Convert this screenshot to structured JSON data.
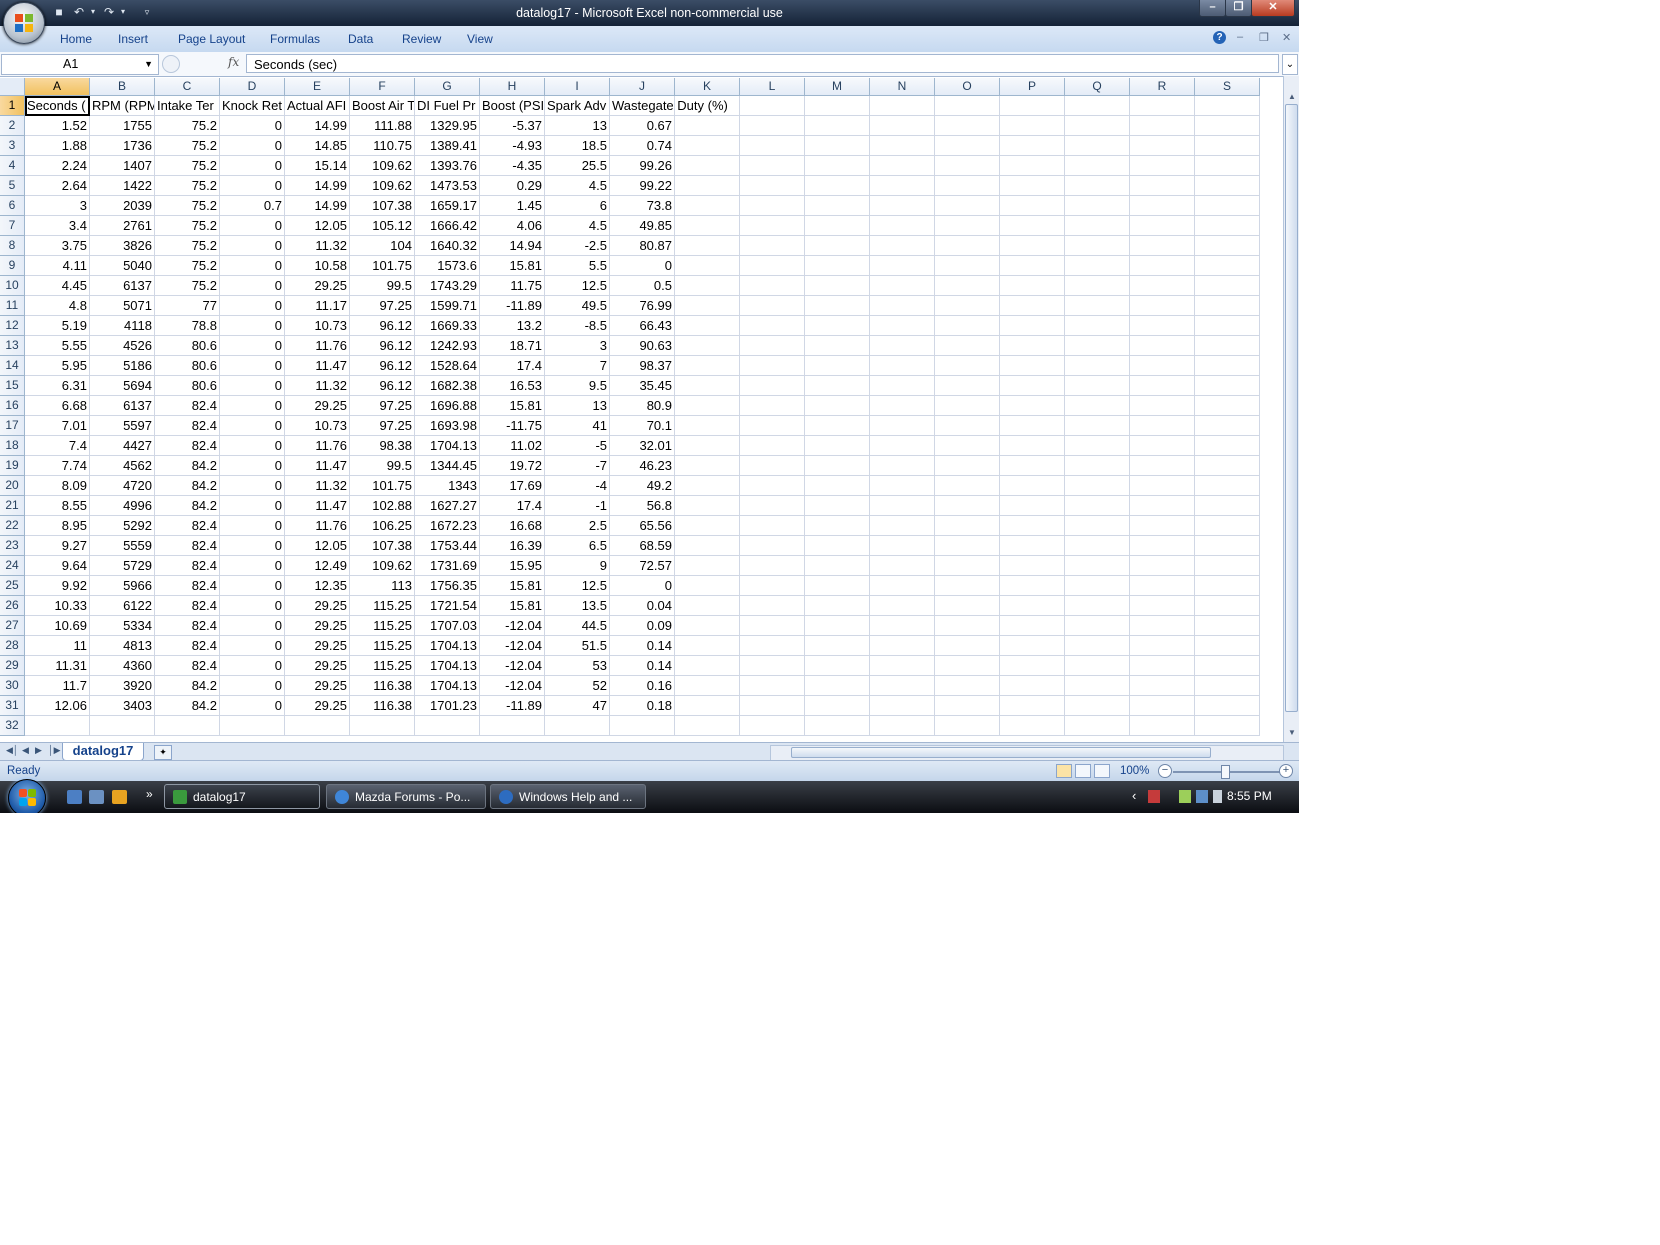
{
  "window": {
    "title": "datalog17 - Microsoft Excel non-commercial use"
  },
  "ribbon": {
    "tabs": [
      "Home",
      "Insert",
      "Page Layout",
      "Formulas",
      "Data",
      "Review",
      "View"
    ]
  },
  "formula_bar": {
    "name_box": "A1",
    "fx_label": "fx",
    "formula": "Seconds (sec)"
  },
  "sheet": {
    "columns": [
      "A",
      "B",
      "C",
      "D",
      "E",
      "F",
      "G",
      "H",
      "I",
      "J",
      "K",
      "L",
      "M",
      "N",
      "O",
      "P",
      "Q",
      "R",
      "S"
    ],
    "headers": [
      "Seconds (",
      "RPM (RPM",
      "Intake Ter",
      "Knock Ret",
      "Actual AFI",
      "Boost Air T",
      "DI Fuel Pr",
      "Boost (PSI",
      "Spark Adv",
      "Wastegate Duty (%)"
    ],
    "rows": [
      [
        "1.52",
        "1755",
        "75.2",
        "0",
        "14.99",
        "111.88",
        "1329.95",
        "-5.37",
        "13",
        "0.67"
      ],
      [
        "1.88",
        "1736",
        "75.2",
        "0",
        "14.85",
        "110.75",
        "1389.41",
        "-4.93",
        "18.5",
        "0.74"
      ],
      [
        "2.24",
        "1407",
        "75.2",
        "0",
        "15.14",
        "109.62",
        "1393.76",
        "-4.35",
        "25.5",
        "99.26"
      ],
      [
        "2.64",
        "1422",
        "75.2",
        "0",
        "14.99",
        "109.62",
        "1473.53",
        "0.29",
        "4.5",
        "99.22"
      ],
      [
        "3",
        "2039",
        "75.2",
        "0.7",
        "14.99",
        "107.38",
        "1659.17",
        "1.45",
        "6",
        "73.8"
      ],
      [
        "3.4",
        "2761",
        "75.2",
        "0",
        "12.05",
        "105.12",
        "1666.42",
        "4.06",
        "4.5",
        "49.85"
      ],
      [
        "3.75",
        "3826",
        "75.2",
        "0",
        "11.32",
        "104",
        "1640.32",
        "14.94",
        "-2.5",
        "80.87"
      ],
      [
        "4.11",
        "5040",
        "75.2",
        "0",
        "10.58",
        "101.75",
        "1573.6",
        "15.81",
        "5.5",
        "0"
      ],
      [
        "4.45",
        "6137",
        "75.2",
        "0",
        "29.25",
        "99.5",
        "1743.29",
        "11.75",
        "12.5",
        "0.5"
      ],
      [
        "4.8",
        "5071",
        "77",
        "0",
        "11.17",
        "97.25",
        "1599.71",
        "-11.89",
        "49.5",
        "76.99"
      ],
      [
        "5.19",
        "4118",
        "78.8",
        "0",
        "10.73",
        "96.12",
        "1669.33",
        "13.2",
        "-8.5",
        "66.43"
      ],
      [
        "5.55",
        "4526",
        "80.6",
        "0",
        "11.76",
        "96.12",
        "1242.93",
        "18.71",
        "3",
        "90.63"
      ],
      [
        "5.95",
        "5186",
        "80.6",
        "0",
        "11.47",
        "96.12",
        "1528.64",
        "17.4",
        "7",
        "98.37"
      ],
      [
        "6.31",
        "5694",
        "80.6",
        "0",
        "11.32",
        "96.12",
        "1682.38",
        "16.53",
        "9.5",
        "35.45"
      ],
      [
        "6.68",
        "6137",
        "82.4",
        "0",
        "29.25",
        "97.25",
        "1696.88",
        "15.81",
        "13",
        "80.9"
      ],
      [
        "7.01",
        "5597",
        "82.4",
        "0",
        "10.73",
        "97.25",
        "1693.98",
        "-11.75",
        "41",
        "70.1"
      ],
      [
        "7.4",
        "4427",
        "82.4",
        "0",
        "11.76",
        "98.38",
        "1704.13",
        "11.02",
        "-5",
        "32.01"
      ],
      [
        "7.74",
        "4562",
        "84.2",
        "0",
        "11.47",
        "99.5",
        "1344.45",
        "19.72",
        "-7",
        "46.23"
      ],
      [
        "8.09",
        "4720",
        "84.2",
        "0",
        "11.32",
        "101.75",
        "1343",
        "17.69",
        "-4",
        "49.2"
      ],
      [
        "8.55",
        "4996",
        "84.2",
        "0",
        "11.47",
        "102.88",
        "1627.27",
        "17.4",
        "-1",
        "56.8"
      ],
      [
        "8.95",
        "5292",
        "82.4",
        "0",
        "11.76",
        "106.25",
        "1672.23",
        "16.68",
        "2.5",
        "65.56"
      ],
      [
        "9.27",
        "5559",
        "82.4",
        "0",
        "12.05",
        "107.38",
        "1753.44",
        "16.39",
        "6.5",
        "68.59"
      ],
      [
        "9.64",
        "5729",
        "82.4",
        "0",
        "12.49",
        "109.62",
        "1731.69",
        "15.95",
        "9",
        "72.57"
      ],
      [
        "9.92",
        "5966",
        "82.4",
        "0",
        "12.35",
        "113",
        "1756.35",
        "15.81",
        "12.5",
        "0"
      ],
      [
        "10.33",
        "6122",
        "82.4",
        "0",
        "29.25",
        "115.25",
        "1721.54",
        "15.81",
        "13.5",
        "0.04"
      ],
      [
        "10.69",
        "5334",
        "82.4",
        "0",
        "29.25",
        "115.25",
        "1707.03",
        "-12.04",
        "44.5",
        "0.09"
      ],
      [
        "11",
        "4813",
        "82.4",
        "0",
        "29.25",
        "115.25",
        "1704.13",
        "-12.04",
        "51.5",
        "0.14"
      ],
      [
        "11.31",
        "4360",
        "82.4",
        "0",
        "29.25",
        "115.25",
        "1704.13",
        "-12.04",
        "53",
        "0.14"
      ],
      [
        "11.7",
        "3920",
        "84.2",
        "0",
        "29.25",
        "116.38",
        "1704.13",
        "-12.04",
        "52",
        "0.16"
      ],
      [
        "12.06",
        "3403",
        "84.2",
        "0",
        "29.25",
        "116.38",
        "1701.23",
        "-11.89",
        "47",
        "0.18"
      ]
    ],
    "row_numbers": [
      "1",
      "2",
      "3",
      "4",
      "5",
      "6",
      "7",
      "8",
      "9",
      "10",
      "11",
      "12",
      "13",
      "14",
      "15",
      "16",
      "17",
      "18",
      "19",
      "20",
      "21",
      "22",
      "23",
      "24",
      "25",
      "26",
      "27",
      "28",
      "29",
      "30",
      "31",
      "32"
    ],
    "sheet_tab": "datalog17"
  },
  "status_bar": {
    "state": "Ready",
    "zoom": "100%"
  },
  "taskbar": {
    "buttons": [
      "datalog17",
      "Mazda Forums - Po...",
      "Windows Help and ..."
    ],
    "clock": "8:55 PM"
  },
  "colors": {
    "title_bar": "#1c2b40",
    "ribbon": "#c6d9f0",
    "selected_header": "#f1c15f",
    "grid_line": "#d0d7e5",
    "ribbon_text": "#15428b"
  }
}
